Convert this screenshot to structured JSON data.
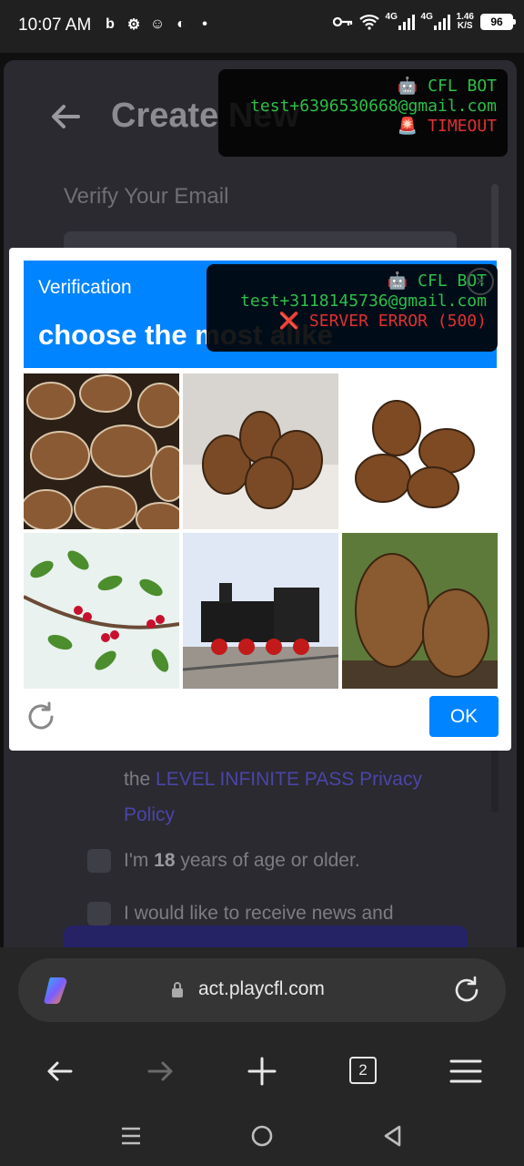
{
  "status_bar": {
    "time": "10:07 AM",
    "icons": [
      "b",
      "⚙",
      "☺",
      "◐",
      "•"
    ],
    "network_speed_value": "1.46",
    "network_speed_unit": "K/S",
    "battery": "96",
    "signal_label": "4G"
  },
  "page": {
    "title": "Create New",
    "subtitle": "Verify Your Email",
    "policy_prefix": "the ",
    "policy_link": "LEVEL INFINITE PASS Privacy Policy",
    "age_prefix": "I'm ",
    "age_bold": "18",
    "age_suffix": " years of age or older.",
    "news_label": "I would like to receive news and"
  },
  "bot_overlay_top": {
    "name": "🤖 CFL BOT",
    "email": "test+6396530668@gmail.com",
    "status": "🚨 TIMEOUT"
  },
  "captcha": {
    "small_title": "Verification",
    "big_title": "choose the most alike",
    "ok_label": "OK",
    "tiles": [
      "pinecones-pile",
      "pinecones-table",
      "pinecones-white",
      "holly-branch",
      "steam-locomotive",
      "pinecones-forest"
    ]
  },
  "bot_overlay_modal": {
    "name": "🤖 CFL BOT",
    "email": "test+3118145736@gmail.com",
    "status": "❌ SERVER ERROR (500)"
  },
  "browser": {
    "url": "act.playcfl.com",
    "tab_count": "2"
  }
}
